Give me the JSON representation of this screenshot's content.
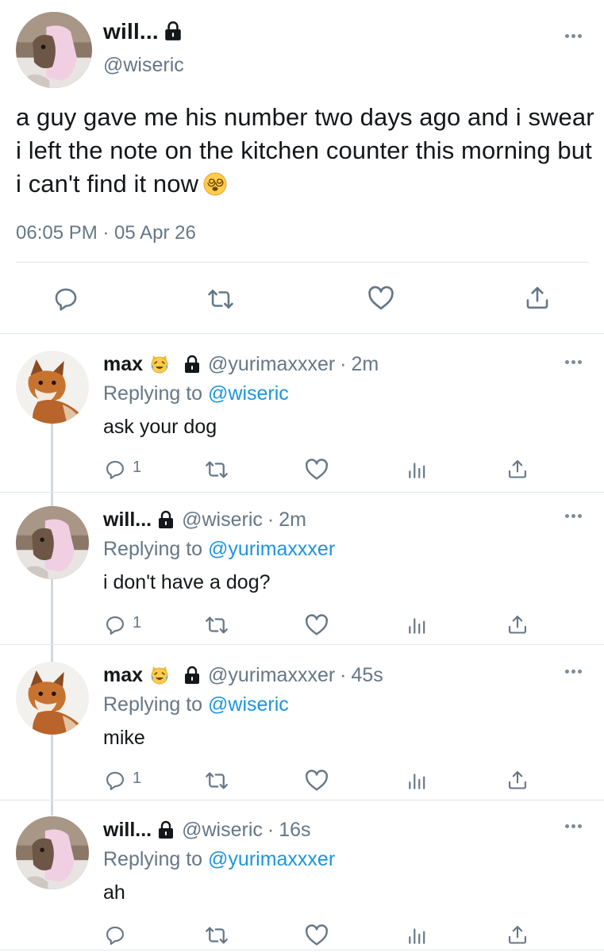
{
  "main_tweet": {
    "name": "will...",
    "handle": "@wiseric",
    "text": "a guy gave me his number two days ago and i swear i left the note on the kitchen counter this morning but i can't find it now",
    "timestamp": "06:05 PM · 05 Apr 26",
    "icons": [
      "lock-icon",
      "more-icon",
      "reply-icon",
      "retweet-icon",
      "like-icon",
      "share-icon"
    ]
  },
  "replies": [
    {
      "name": "max",
      "handle": "@yurimaxxxer",
      "separator": "·",
      "time": "2m",
      "replying_prefix": "Replying to",
      "replying_to": "@wiseric",
      "text": "ask your dog",
      "reply_count": "1"
    },
    {
      "name": "will...",
      "handle": "@wiseric",
      "separator": "·",
      "time": "2m",
      "replying_prefix": "Replying to",
      "replying_to": "@yurimaxxxer",
      "text": "i don't have a dog?",
      "reply_count": "1"
    },
    {
      "name": "max",
      "handle": "@yurimaxxxer",
      "separator": "·",
      "time": "45s",
      "replying_prefix": "Replying to",
      "replying_to": "@wiseric",
      "text": "mike",
      "reply_count": "1"
    },
    {
      "name": "will...",
      "handle": "@wiseric",
      "separator": "·",
      "time": "16s",
      "replying_prefix": "Replying to",
      "replying_to": "@yurimaxxxer",
      "text": "ah",
      "reply_count": ""
    }
  ],
  "colors": {
    "text": "#14171a",
    "secondary": "#657786",
    "link": "#1b95e0",
    "divider": "#e1e8ed",
    "icon": "#657786"
  }
}
